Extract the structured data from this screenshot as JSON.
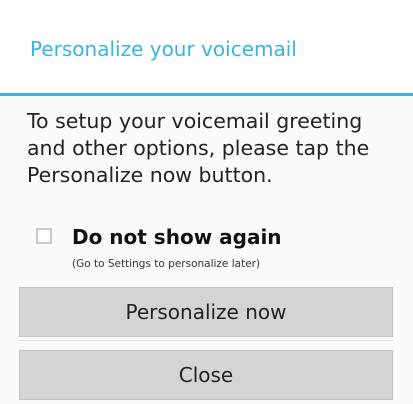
{
  "dialog": {
    "title": "Personalize your voicemail",
    "message": "To setup your voicemail greeting and other options, please tap the Personalize now button.",
    "checkbox": {
      "label": "Do not show again",
      "hint": "(Go to Settings to personalize later)",
      "checked": false
    },
    "buttons": {
      "personalize_label": "Personalize now",
      "close_label": "Close"
    }
  },
  "colors": {
    "accent": "#35b5e5",
    "button_bg": "#d4d4d4"
  }
}
